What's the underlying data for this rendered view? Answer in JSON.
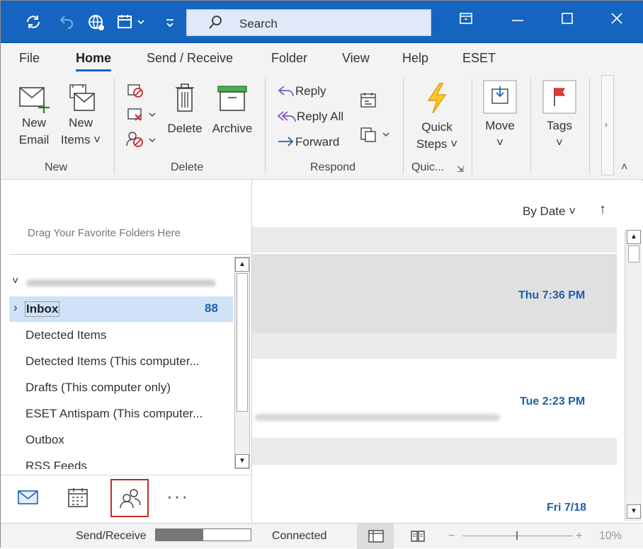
{
  "titlebar": {
    "search_placeholder": "Search",
    "icons": [
      "sync-icon",
      "undo-icon",
      "globe-icon",
      "calendar-dropdown-icon",
      "customize-icon",
      "search-icon",
      "window-mode-icon",
      "minimize-icon",
      "maximize-icon",
      "close-icon"
    ]
  },
  "tabs": [
    "File",
    "Home",
    "Send / Receive",
    "Folder",
    "View",
    "Help",
    "ESET"
  ],
  "ribbon": {
    "new_email_l1": "New",
    "new_email_l2": "Email",
    "new_items_l1": "New",
    "new_items_l2": "Items",
    "delete": "Delete",
    "archive": "Archive",
    "reply": "Reply",
    "reply_all": "Reply All",
    "forward": "Forward",
    "quick_steps_l1": "Quick",
    "quick_steps_l2": "Steps",
    "move": "Move",
    "tags": "Tags",
    "groups": {
      "new": "New",
      "delete": "Delete",
      "respond": "Respond",
      "quick": "Quic..."
    }
  },
  "nav": {
    "favorites_hint": "Drag Your Favorite Folders Here",
    "folders": [
      {
        "name": "Inbox",
        "count": "88"
      },
      {
        "name": "Detected Items"
      },
      {
        "name": "Detected Items (This computer..."
      },
      {
        "name": "Drafts (This computer only)"
      },
      {
        "name": "ESET Antispam (This computer..."
      },
      {
        "name": "Outbox"
      },
      {
        "name": "RSS Feeds"
      }
    ],
    "bottom_icons": [
      "mail-icon",
      "calendar-icon",
      "people-icon",
      "more-icon"
    ]
  },
  "list": {
    "sort_label": "By Date",
    "dates": [
      "Thu 7:36 PM",
      "Tue 2:23 PM",
      "Fri 7/18"
    ]
  },
  "status": {
    "send_receive": "Send/Receive",
    "progress": 0.5,
    "connected": "Connected",
    "zoom": "10%"
  },
  "colors": {
    "accent": "#1565c0",
    "date_text": "#1f5fa8",
    "selection": "#cfe2f7",
    "highlight_box": "#c62828"
  }
}
